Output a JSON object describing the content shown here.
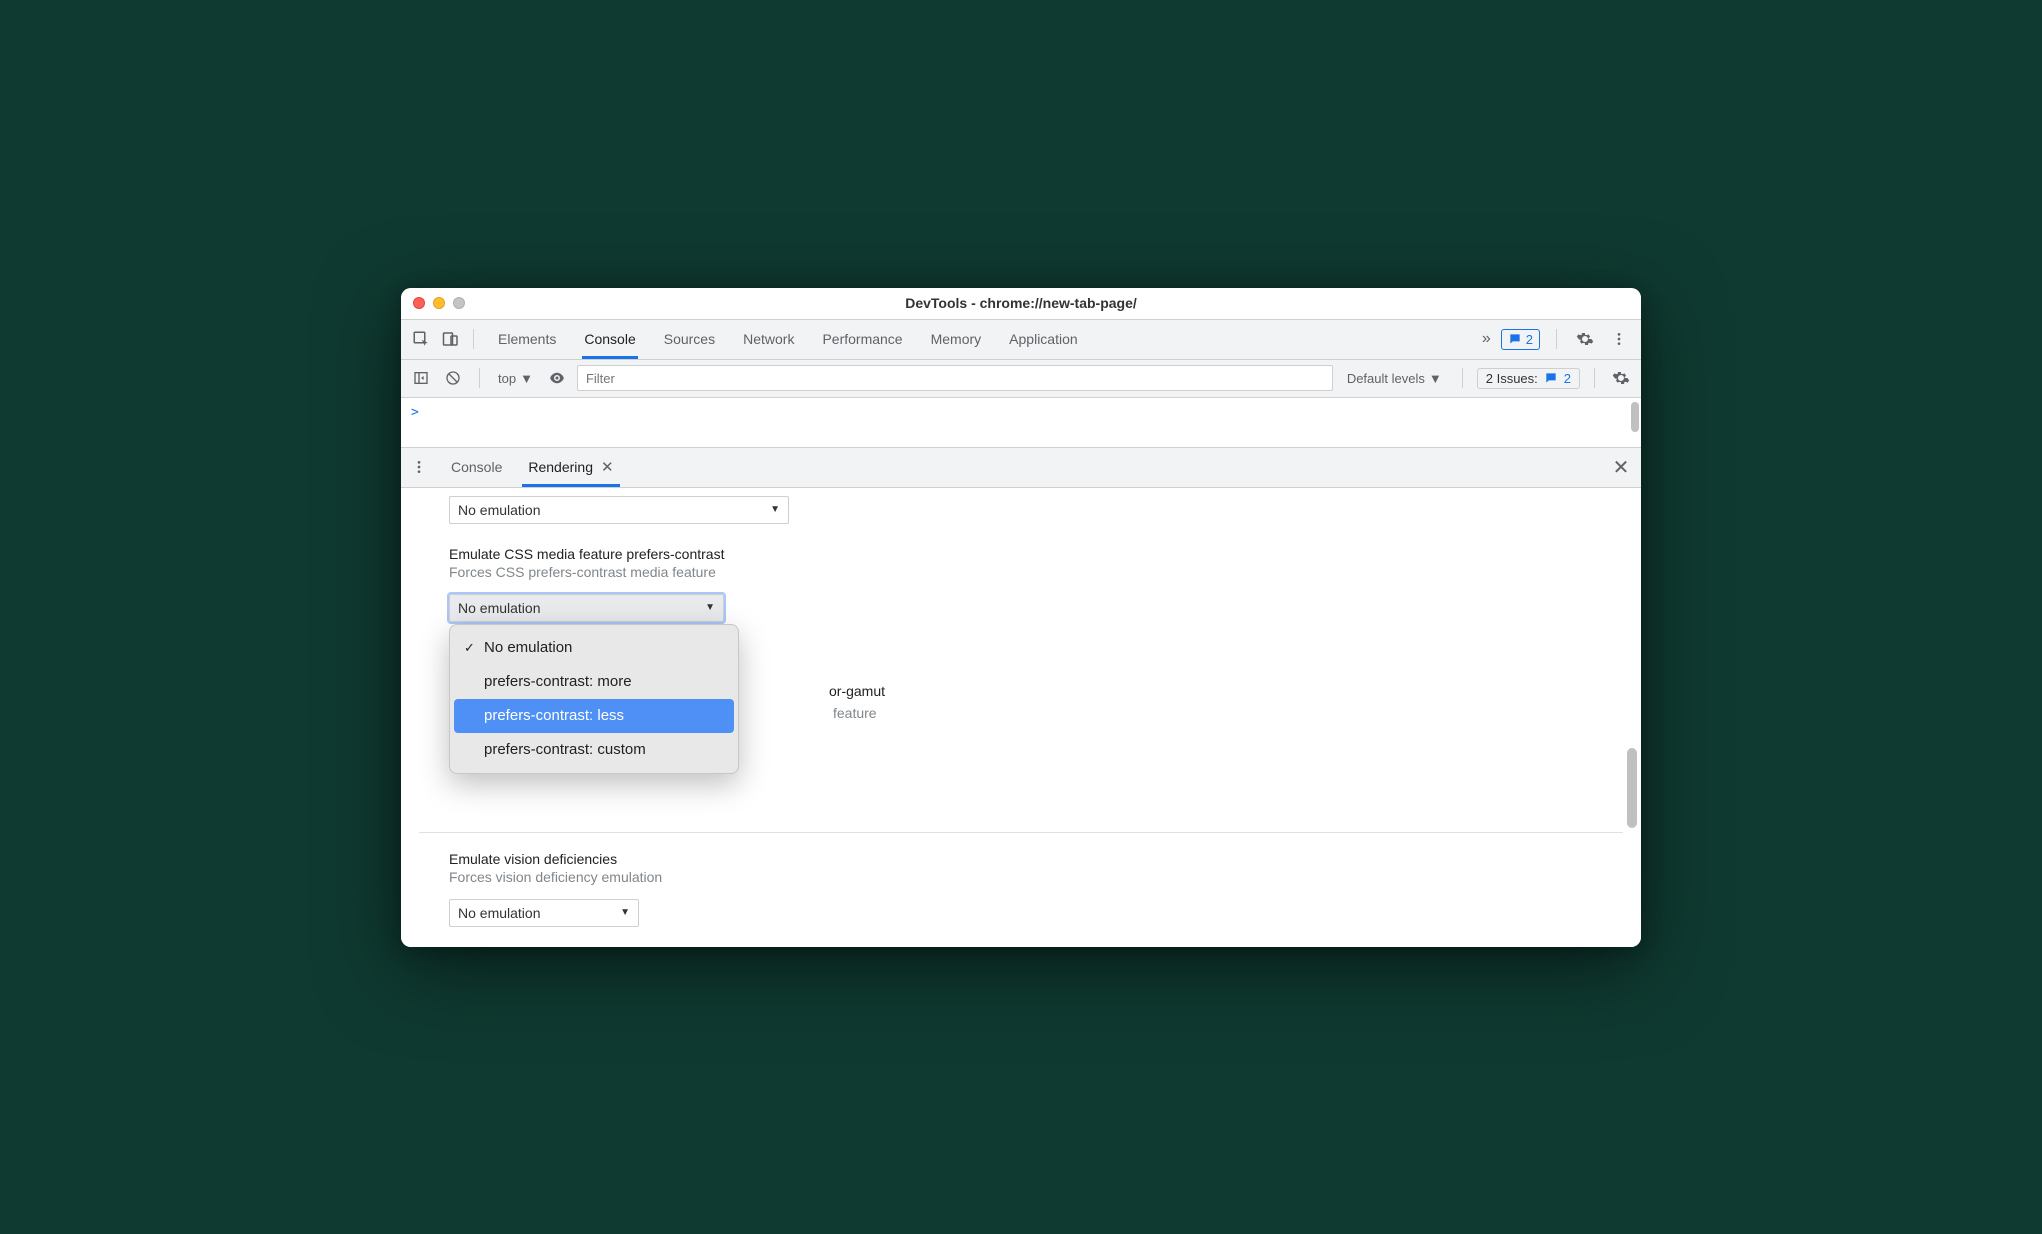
{
  "window_title": "DevTools - chrome://new-tab-page/",
  "main_tabs": [
    "Elements",
    "Console",
    "Sources",
    "Network",
    "Performance",
    "Memory",
    "Application"
  ],
  "main_tabs_active": "Console",
  "chat_badge_count": "2",
  "console": {
    "context": "top",
    "filter_placeholder": "Filter",
    "levels": "Default levels",
    "issues_label": "2 Issues:",
    "issues_count": "2"
  },
  "drawer_tabs": {
    "items": [
      "Console",
      "Rendering"
    ],
    "active": "Rendering"
  },
  "rendering": {
    "top_select_value": "No emulation",
    "contrast": {
      "title": "Emulate CSS media feature prefers-contrast",
      "desc": "Forces CSS prefers-contrast media feature",
      "selected": "No emulation",
      "options": [
        "No emulation",
        "prefers-contrast: more",
        "prefers-contrast: less",
        "prefers-contrast: custom"
      ],
      "checked_index": 0,
      "highlight_index": 2
    },
    "gamut": {
      "title_partial": "or-gamut",
      "desc_partial": "feature"
    },
    "vision": {
      "title": "Emulate vision deficiencies",
      "desc": "Forces vision deficiency emulation",
      "selected": "No emulation"
    }
  }
}
